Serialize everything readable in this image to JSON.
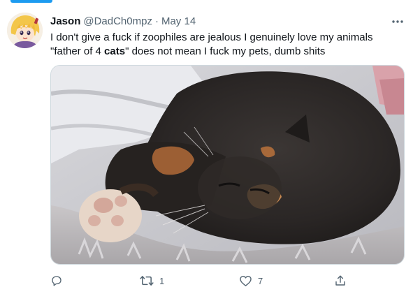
{
  "tweet": {
    "display_name": "Jason",
    "handle": "@DadCh0mpz",
    "separator": "·",
    "date": "May 14",
    "text_line1": "I don't give a fuck if zoophiles are jealous I genuinely love my animals",
    "text_line2_prefix": "\"father of 4 ",
    "text_line2_bold": "cats",
    "text_line2_suffix": "\" does not mean I fuck my pets, dumb shits",
    "media_alt": "calico cat sleeping on fluffy blanket",
    "more_icon": "more-horizontal-icon"
  },
  "actions": {
    "reply": {
      "icon": "reply-icon",
      "count": ""
    },
    "retweet": {
      "icon": "retweet-icon",
      "count": "1"
    },
    "like": {
      "icon": "heart-icon",
      "count": "7"
    },
    "share": {
      "icon": "share-icon",
      "count": ""
    }
  },
  "colors": {
    "accent": "#1d9bf0",
    "text_primary": "#0f1419",
    "text_secondary": "#536471"
  }
}
